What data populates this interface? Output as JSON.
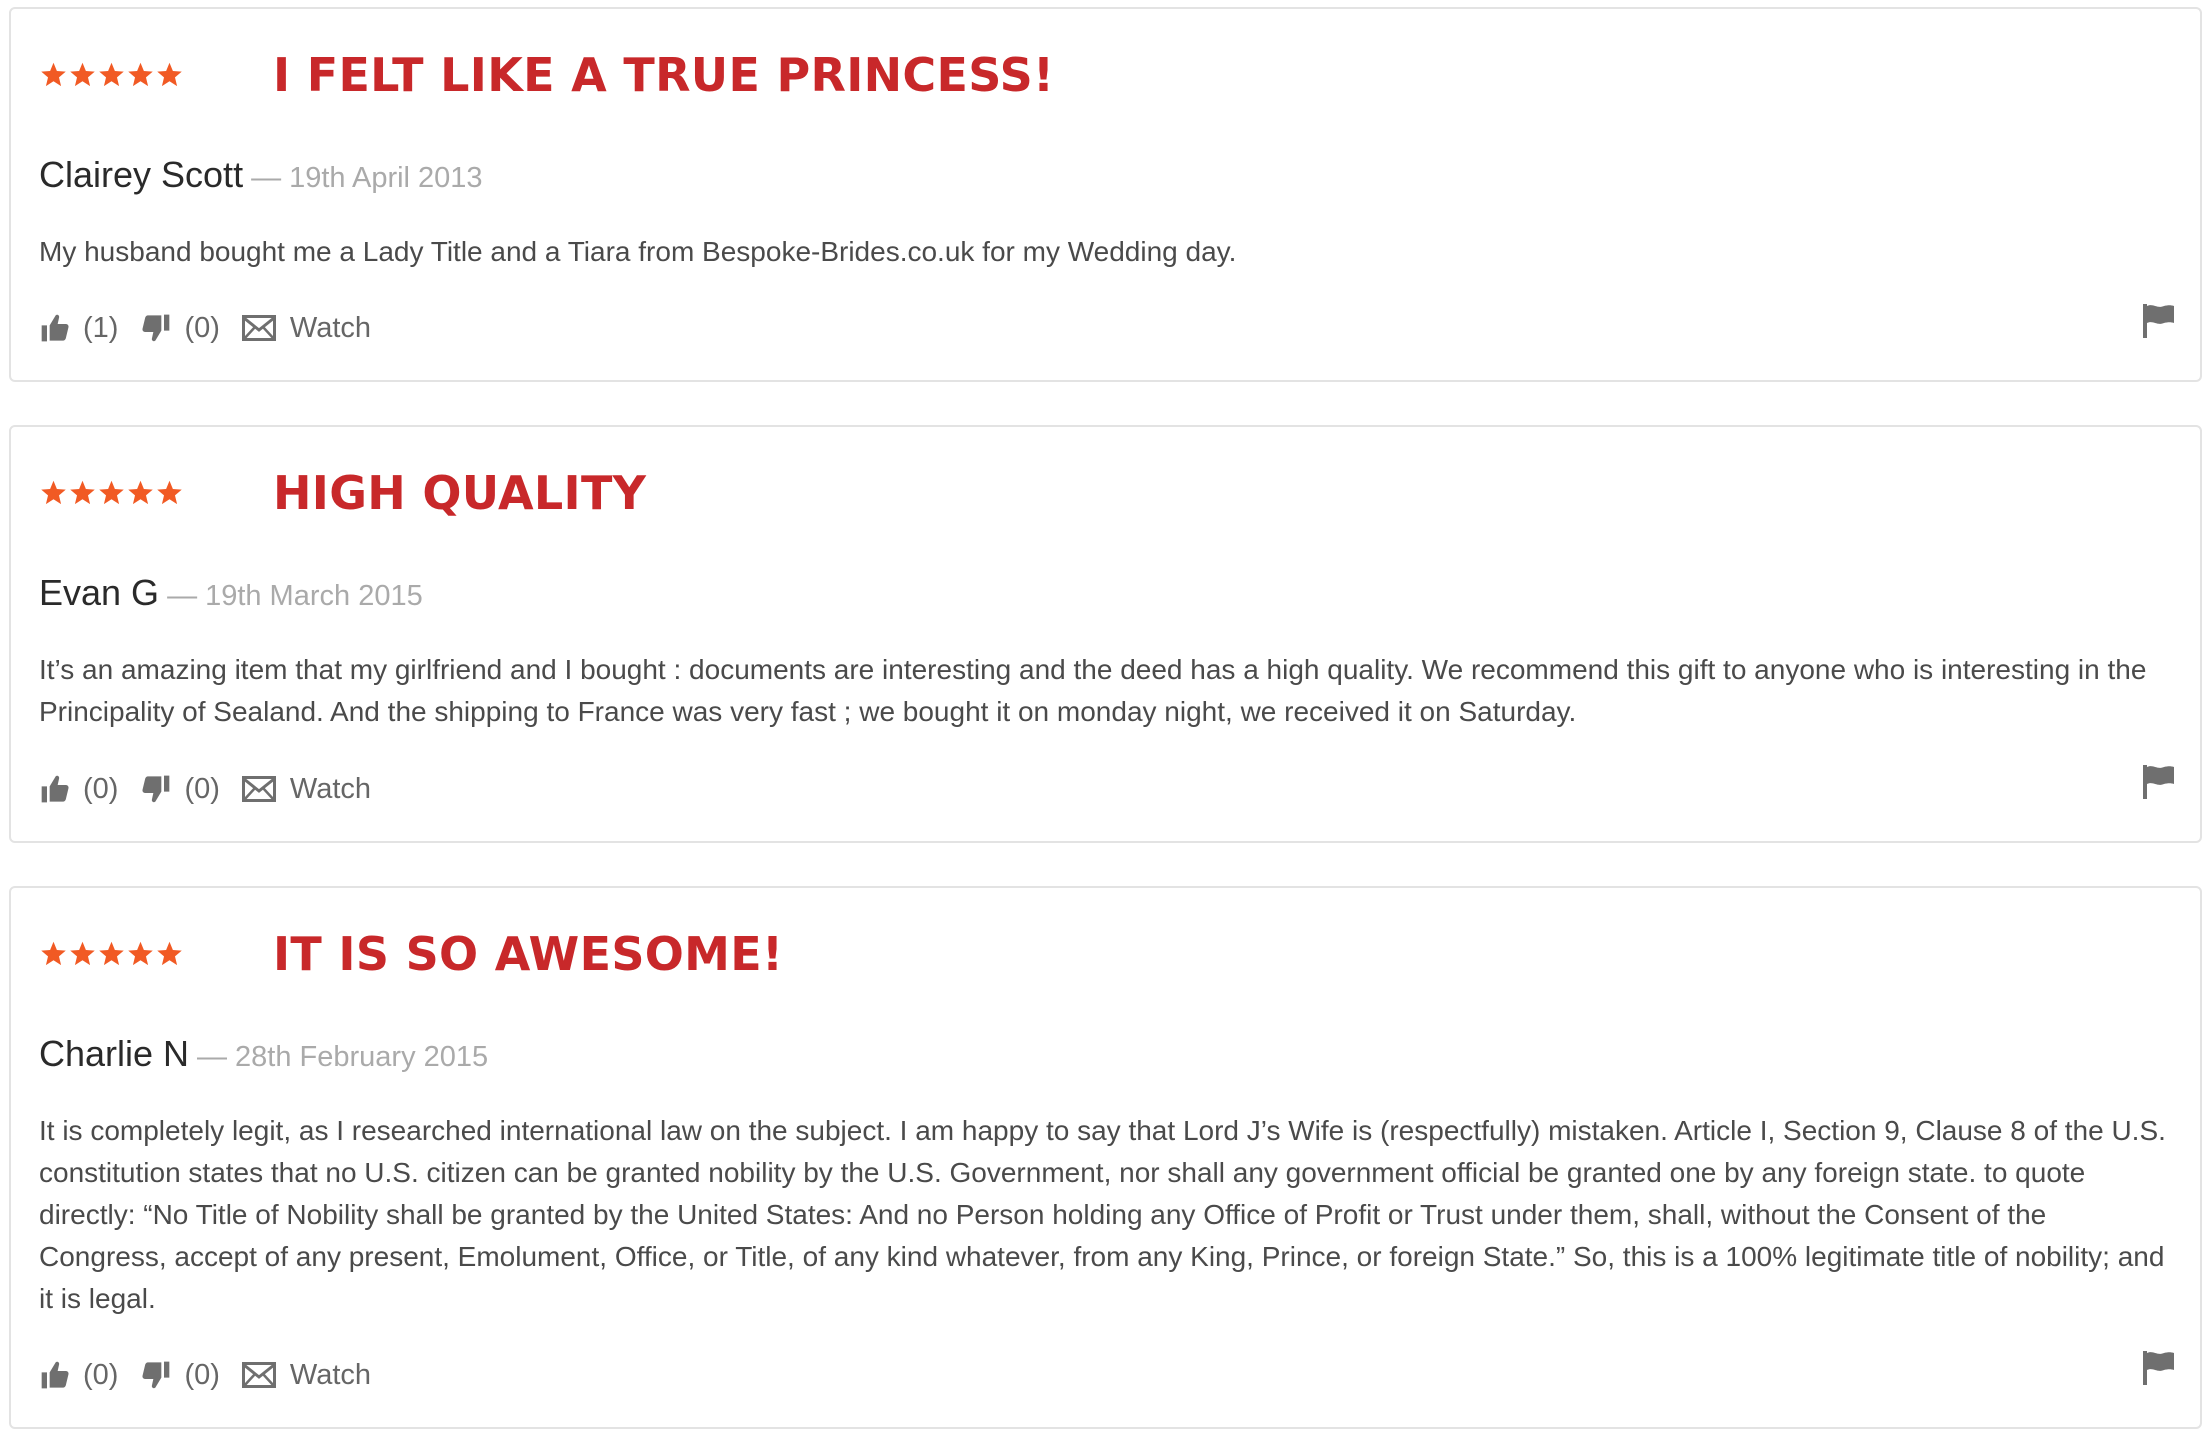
{
  "colors": {
    "star": "#f15a24",
    "title": "#c8282a",
    "icon": "#6f6f6f",
    "border": "#e3e3e3"
  },
  "reviews": [
    {
      "rating": 5,
      "title": "I FELT LIKE A TRUE PRINCESS!",
      "author": "Clairey Scott",
      "separator": "—",
      "date": "19th April 2013",
      "body": "My husband bought me a Lady Title and a Tiara from Bespoke-Brides.co.uk for my Wedding day.",
      "upvotes": "(1)",
      "downvotes": "(0)",
      "watch_label": "Watch"
    },
    {
      "rating": 5,
      "title": "HIGH QUALITY",
      "author": "Evan G",
      "separator": "—",
      "date": "19th March 2015",
      "body": "It’s an amazing item that my girlfriend and I bought : documents are interesting and the deed has a high quality. We recommend this gift to anyone who is interesting in the Principality of Sealand. And the shipping to France was very fast ; we bought it on monday night, we received it on Saturday.",
      "upvotes": "(0)",
      "downvotes": "(0)",
      "watch_label": "Watch"
    },
    {
      "rating": 5,
      "title": "IT IS SO AWESOME!",
      "author": "Charlie N",
      "separator": "—",
      "date": "28th February 2015",
      "body": "It is completely legit, as I researched international law on the subject. I am happy to say that Lord J’s Wife is (respectfully) mistaken. Article I, Section 9, Clause 8 of the U.S. constitution states that no U.S. citizen can be granted nobility by the U.S. Government, nor shall any government official be granted one by any foreign state. to quote directly: “No Title of Nobility shall be granted by the United States: And no Person holding any Office of Profit or Trust under them, shall, without the Consent of the Congress, accept of any present, Emolument, Office, or Title, of any kind whatever, from any King, Prince, or foreign State.” So, this is a 100% legitimate title of nobility; and it is legal.",
      "upvotes": "(0)",
      "downvotes": "(0)",
      "watch_label": "Watch"
    }
  ]
}
